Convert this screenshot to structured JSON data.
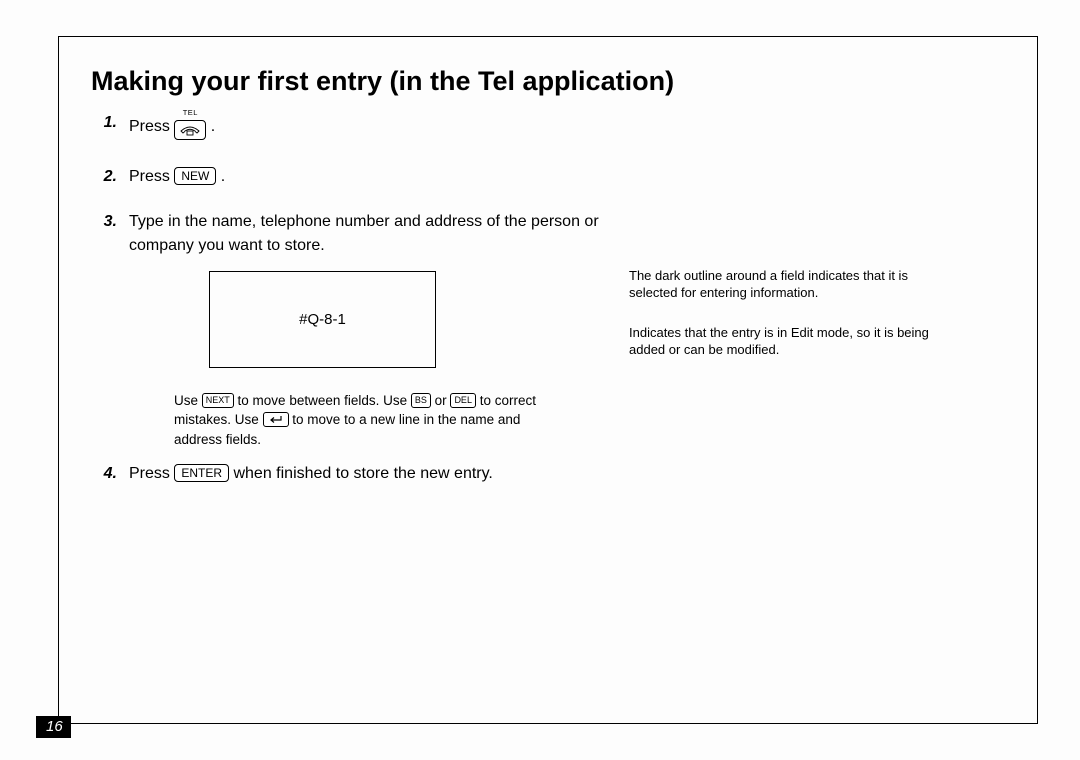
{
  "page_number": "16",
  "title": "Making your first entry (in the Tel application)",
  "steps": {
    "s1": {
      "num": "1.",
      "text_a": "Press ",
      "text_b": " ."
    },
    "s2": {
      "num": "2.",
      "text_a": "Press ",
      "key": "NEW",
      "text_b": " ."
    },
    "s3": {
      "num": "3.",
      "text": "Type in the name, telephone number and address of the person or company you want to store."
    },
    "s4": {
      "num": "4.",
      "text_a": "Press ",
      "key": "ENTER",
      "text_b": " when finished to store the new entry."
    }
  },
  "tel_key_label": "TEL",
  "screen_placeholder": "#Q-8-1",
  "right_notes": {
    "n1": "The dark outline around a field indicates that it is selected for entering information.",
    "n2": "Indicates that the entry is in Edit mode, so it is being added or can be modified."
  },
  "small_note": {
    "a": "Use ",
    "key_next": "NEXT",
    "b": " to move between fields. Use ",
    "key_bs": "BS",
    "c": " or ",
    "key_del": "DEL",
    "d": " to correct mistakes. Use ",
    "e": " to move to a new line in the name and address fields."
  }
}
